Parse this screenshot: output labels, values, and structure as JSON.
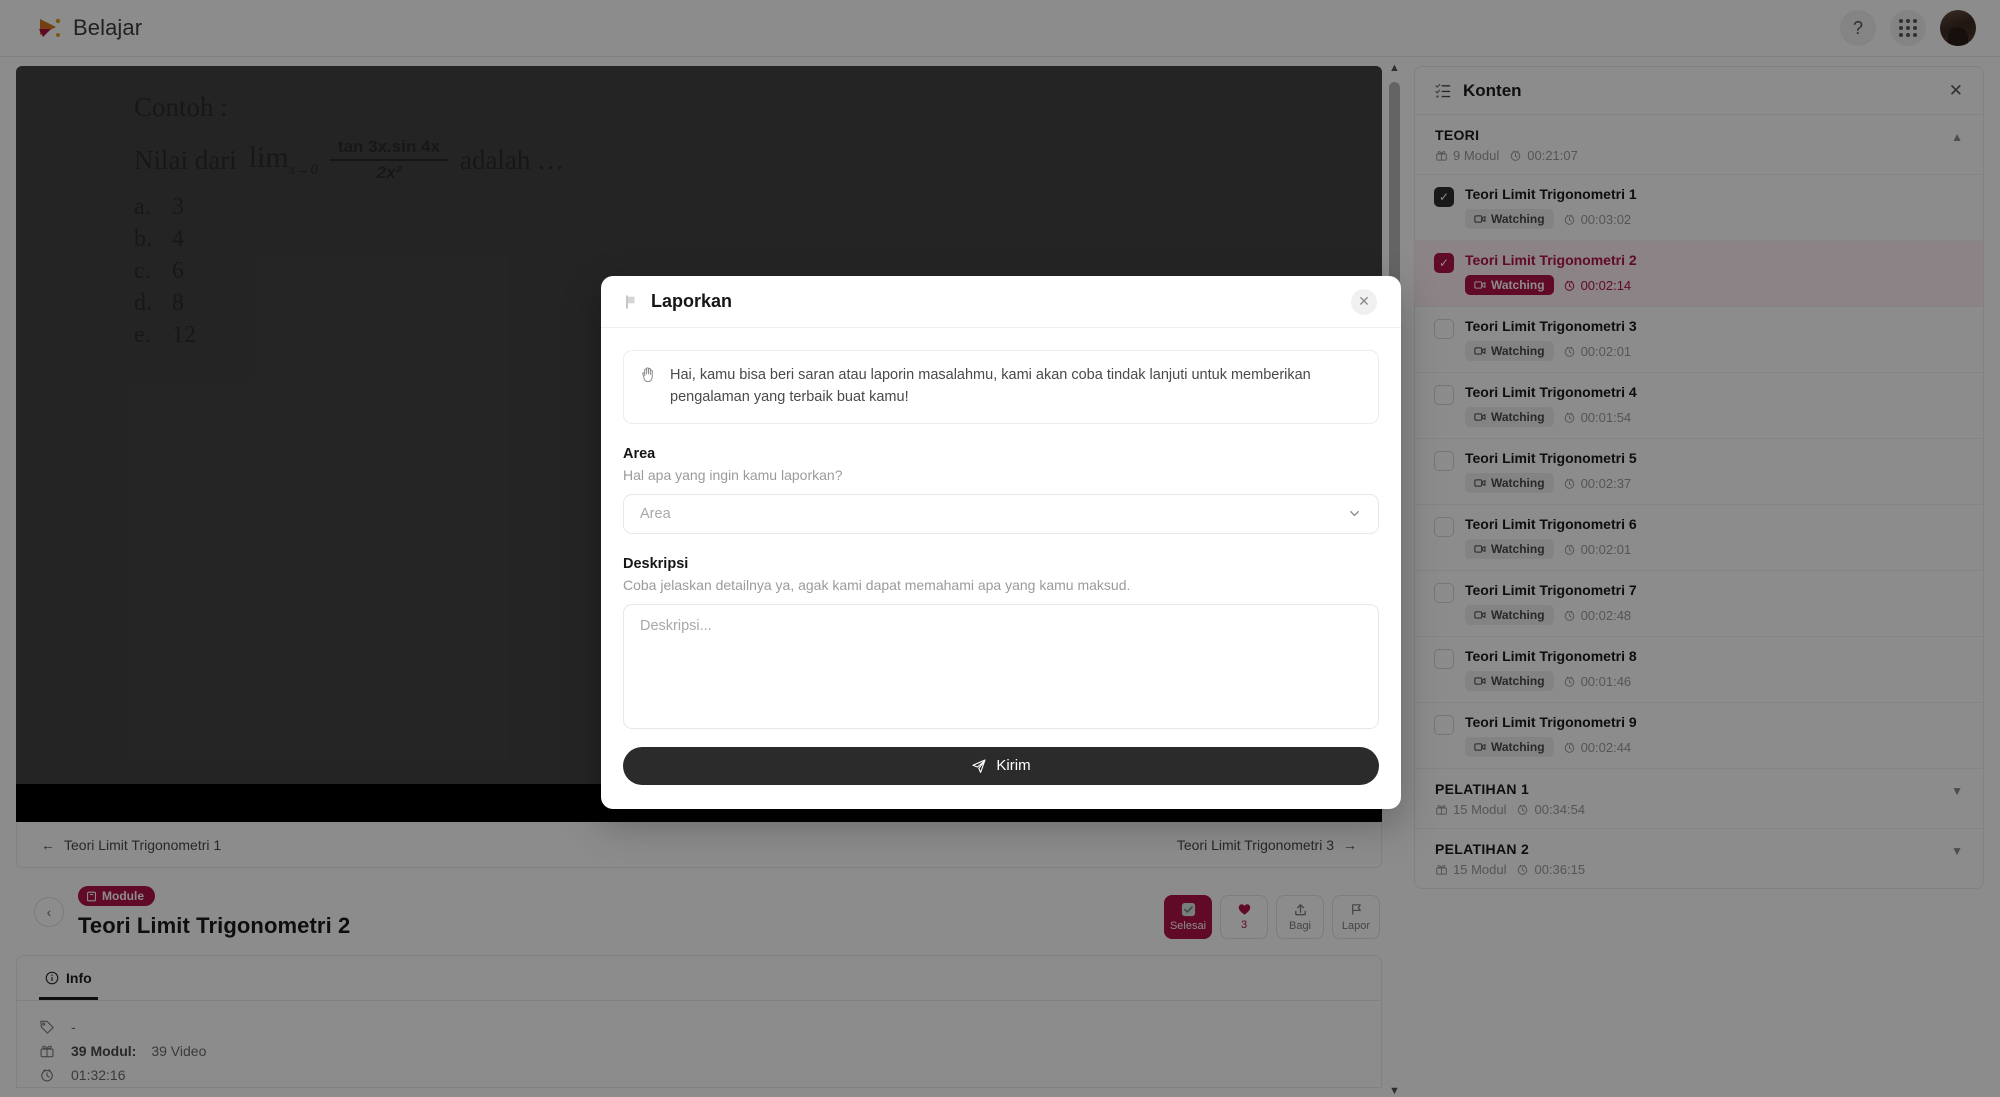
{
  "topbar": {
    "brand": "Belajar",
    "help_icon": "question-mark-icon",
    "apps_icon": "grid-apps-icon",
    "avatar_icon": "user-avatar"
  },
  "player": {
    "slide": {
      "heading": "Contoh :",
      "prompt_prefix": "Nilai dari",
      "limit": "lim",
      "limit_sub": "x→0",
      "numerator": "tan 3x.sin 4x",
      "denominator": "2x²",
      "prompt_suffix": "adalah …",
      "options": [
        {
          "key": "a.",
          "value": "3"
        },
        {
          "key": "b.",
          "value": "4"
        },
        {
          "key": "c.",
          "value": "6"
        },
        {
          "key": "d.",
          "value": "8"
        },
        {
          "key": "e.",
          "value": "12"
        }
      ]
    },
    "nav_prev": "Teori Limit Trigonometri 1",
    "nav_next": "Teori Limit Trigonometri 3"
  },
  "action_bar": {
    "back_icon": "chevron-left-icon",
    "badge": "Module",
    "badge_icon": "book-icon",
    "title": "Teori Limit Trigonometri 2",
    "buttons": [
      {
        "label": "Selesai",
        "icon": "check-square-icon",
        "state": "primary"
      },
      {
        "label": "3",
        "icon": "heart-icon",
        "state": "love"
      },
      {
        "label": "Bagi",
        "icon": "share-icon",
        "state": "default"
      },
      {
        "label": "Lapor",
        "icon": "flag-icon",
        "state": "default"
      }
    ]
  },
  "info_panel": {
    "tabs": [
      {
        "label": "Info",
        "icon": "info-circle-icon",
        "active": true
      }
    ],
    "rows": [
      {
        "icon": "tag-icon",
        "text": "-",
        "strong": ""
      },
      {
        "icon": "gift-icon",
        "strong": "39 Modul:",
        "text": "39 Video"
      },
      {
        "icon": "clock-icon",
        "strong": "",
        "text": "01:32:16"
      }
    ]
  },
  "sidebar": {
    "title": "Konten",
    "list_icon": "checklist-icon",
    "close_icon": "close-icon",
    "sections": [
      {
        "name": "TEORI",
        "modules": "9 Modul",
        "duration": "00:21:07",
        "expanded": true,
        "chevron": "chevron-up-icon",
        "lessons": [
          {
            "title": "Teori Limit Trigonometri 1",
            "status": "Watching",
            "duration": "00:03:02",
            "check": "done",
            "active": false
          },
          {
            "title": "Teori Limit Trigonometri 2",
            "status": "Watching",
            "duration": "00:02:14",
            "check": "current",
            "active": true
          },
          {
            "title": "Teori Limit Trigonometri 3",
            "status": "Watching",
            "duration": "00:02:01",
            "check": "none",
            "active": false
          },
          {
            "title": "Teori Limit Trigonometri 4",
            "status": "Watching",
            "duration": "00:01:54",
            "check": "none",
            "active": false
          },
          {
            "title": "Teori Limit Trigonometri 5",
            "status": "Watching",
            "duration": "00:02:37",
            "check": "none",
            "active": false
          },
          {
            "title": "Teori Limit Trigonometri 6",
            "status": "Watching",
            "duration": "00:02:01",
            "check": "none",
            "active": false
          },
          {
            "title": "Teori Limit Trigonometri 7",
            "status": "Watching",
            "duration": "00:02:48",
            "check": "none",
            "active": false
          },
          {
            "title": "Teori Limit Trigonometri 8",
            "status": "Watching",
            "duration": "00:01:46",
            "check": "none",
            "active": false
          },
          {
            "title": "Teori Limit Trigonometri 9",
            "status": "Watching",
            "duration": "00:02:44",
            "check": "none",
            "active": false
          }
        ]
      },
      {
        "name": "PELATIHAN 1",
        "modules": "15 Modul",
        "duration": "00:34:54",
        "expanded": false,
        "chevron": "chevron-down-icon",
        "lessons": []
      },
      {
        "name": "PELATIHAN 2",
        "modules": "15 Modul",
        "duration": "00:36:15",
        "expanded": false,
        "chevron": "chevron-down-icon",
        "lessons": []
      }
    ]
  },
  "modal": {
    "title": "Laporkan",
    "title_icon": "flag-icon",
    "close_icon": "close-icon",
    "notice_icon": "waving-hand-icon",
    "notice": "Hai, kamu bisa beri saran atau laporin masalahmu, kami akan coba tindak lanjuti untuk memberikan pengalaman yang terbaik buat kamu!",
    "area_label": "Area",
    "area_help": "Hal apa yang ingin kamu laporkan?",
    "area_placeholder": "Area",
    "area_value": "",
    "area_chevron": "chevron-down-icon",
    "desc_label": "Deskripsi",
    "desc_help": "Coba jelaskan detailnya ya, agak kami dapat memahami apa yang kamu maksud.",
    "desc_placeholder": "Deskripsi...",
    "desc_value": "",
    "submit_label": "Kirim",
    "submit_icon": "send-icon"
  },
  "colors": {
    "accent": "#b0134a",
    "dark": "#2b2b2b",
    "muted": "#9b9b9b"
  }
}
